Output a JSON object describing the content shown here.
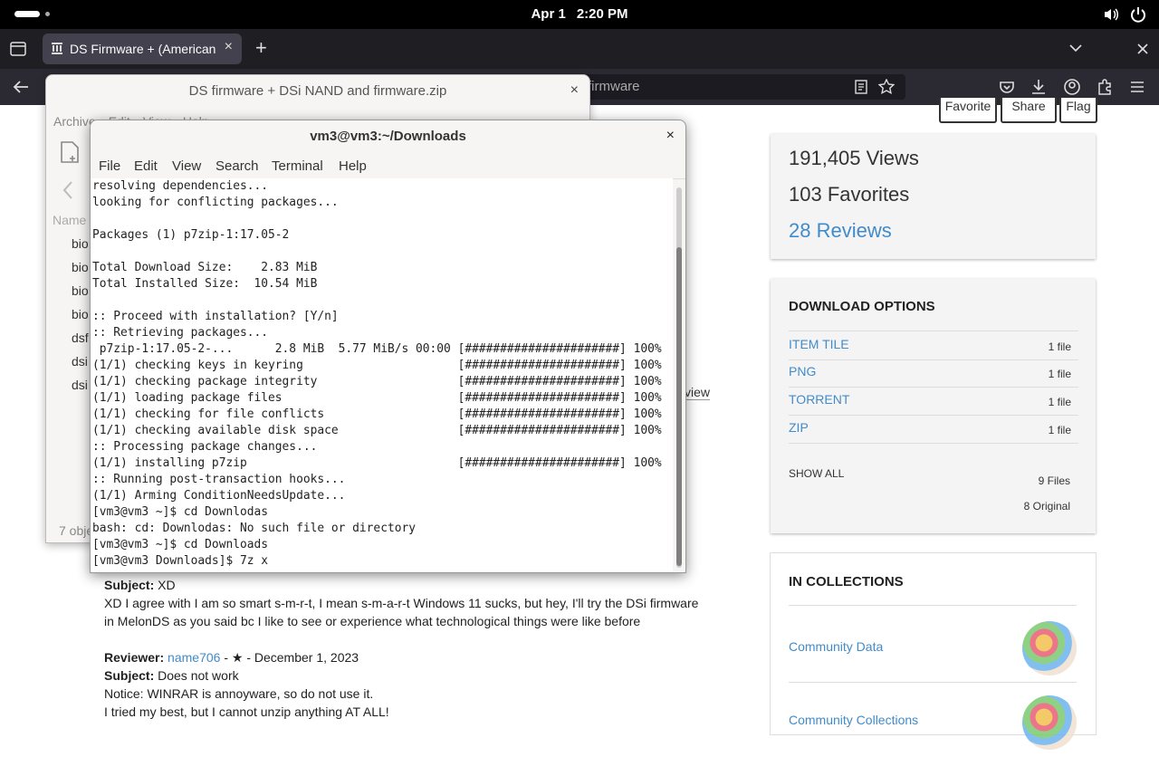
{
  "topbar": {
    "date": "Apr 1",
    "time": "2:20 PM"
  },
  "browser": {
    "tab_title": "DS Firmware + (American",
    "url_fragment": "firmware"
  },
  "page": {
    "buttons": {
      "favorite": "Favorite",
      "share": "Share",
      "flag": "Flag"
    },
    "stats": {
      "views": "191,405 Views",
      "favorites": "103 Favorites",
      "reviews": "28 Reviews"
    },
    "download": {
      "heading": "DOWNLOAD OPTIONS",
      "items": [
        {
          "name": "ITEM TILE",
          "count": "1 file"
        },
        {
          "name": "PNG",
          "count": "1 file"
        },
        {
          "name": "TORRENT",
          "count": "1 file"
        },
        {
          "name": "ZIP",
          "count": "1 file"
        }
      ],
      "show_all": "SHOW ALL",
      "files": "9 Files",
      "original": "8 Original"
    },
    "collections": {
      "heading": "IN COLLECTIONS",
      "items": [
        "Community Data",
        "Community Collections"
      ]
    },
    "partial_link": "view",
    "reviews": {
      "r1_subject_label": "Subject:",
      "r1_subject": "XD",
      "r1_body_1": "XD I agree with I am so smart s-m-r-t, I mean s-m-a-r-t Windows 11 sucks, but hey, I'll try the DSi firmware",
      "r1_body_2": "in MelonDS as you said bc I like to see or experience what technological things were like before",
      "r2_reviewer_label": "Reviewer:",
      "r2_reviewer": "name706",
      "r2_meta": " - ★ - December 1, 2023",
      "r2_subject_label": "Subject:",
      "r2_subject": "Does not work",
      "r2_body_1": "Notice: WINRAR is annoyware, so do not use it.",
      "r2_body_2": "I tried my best, but I cannot unzip anything AT ALL!"
    }
  },
  "archive_window": {
    "title": "DS firmware + DSi NAND and firmware.zip",
    "menu": [
      "Archive",
      "Edit",
      "View",
      "Help"
    ],
    "column_name": "Name",
    "files": [
      "bio",
      "bio",
      "bio",
      "bio",
      "dsf",
      "dsi",
      "dsi"
    ],
    "status": "7 obje"
  },
  "terminal": {
    "title": "vm3@vm3:~/Downloads",
    "menu": [
      "File",
      "Edit",
      "View",
      "Search",
      "Terminal",
      "Help"
    ],
    "lines": [
      "resolving dependencies...",
      "looking for conflicting packages...",
      "",
      "Packages (1) p7zip-1:17.05-2",
      "",
      "Total Download Size:    2.83 MiB",
      "Total Installed Size:  10.54 MiB",
      "",
      ":: Proceed with installation? [Y/n]",
      ":: Retrieving packages...",
      " p7zip-1:17.05-2-...      2.8 MiB  5.77 MiB/s 00:00 [######################] 100%",
      "(1/1) checking keys in keyring                      [######################] 100%",
      "(1/1) checking package integrity                    [######################] 100%",
      "(1/1) loading package files                         [######################] 100%",
      "(1/1) checking for file conflicts                   [######################] 100%",
      "(1/1) checking available disk space                 [######################] 100%",
      ":: Processing package changes...",
      "(1/1) installing p7zip                              [######################] 100%",
      ":: Running post-transaction hooks...",
      "(1/1) Arming ConditionNeedsUpdate...",
      "[vm3@vm3 ~]$ cd Downlodas",
      "bash: cd: Downlodas: No such file or directory",
      "[vm3@vm3 ~]$ cd Downloads",
      "[vm3@vm3 Downloads]$ 7z x"
    ]
  }
}
